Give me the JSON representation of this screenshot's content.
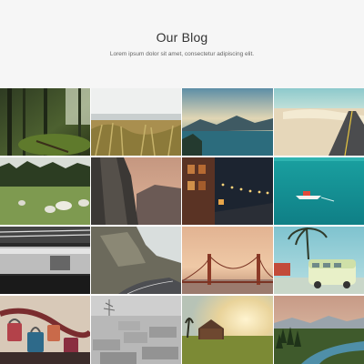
{
  "header": {
    "title": "Our Blog",
    "subtitle": "Lorem ipsum dolor sit amet, consectetur adipiscing elit."
  },
  "gallery": {
    "tiles": [
      {
        "icon": "forest-photo"
      },
      {
        "icon": "beach-grass-photo"
      },
      {
        "icon": "lake-mountains-photo"
      },
      {
        "icon": "desert-road-photo"
      },
      {
        "icon": "sheep-meadow-photo"
      },
      {
        "icon": "cliff-valley-photo"
      },
      {
        "icon": "night-street-photo"
      },
      {
        "icon": "boat-sea-photo"
      },
      {
        "icon": "subway-station-photo"
      },
      {
        "icon": "mountain-road-photo"
      },
      {
        "icon": "golden-gate-photo"
      },
      {
        "icon": "van-palms-photo"
      },
      {
        "icon": "love-locks-photo"
      },
      {
        "icon": "memorial-blocks-photo"
      },
      {
        "icon": "cabin-sunset-photo"
      },
      {
        "icon": "river-valley-photo"
      }
    ]
  }
}
